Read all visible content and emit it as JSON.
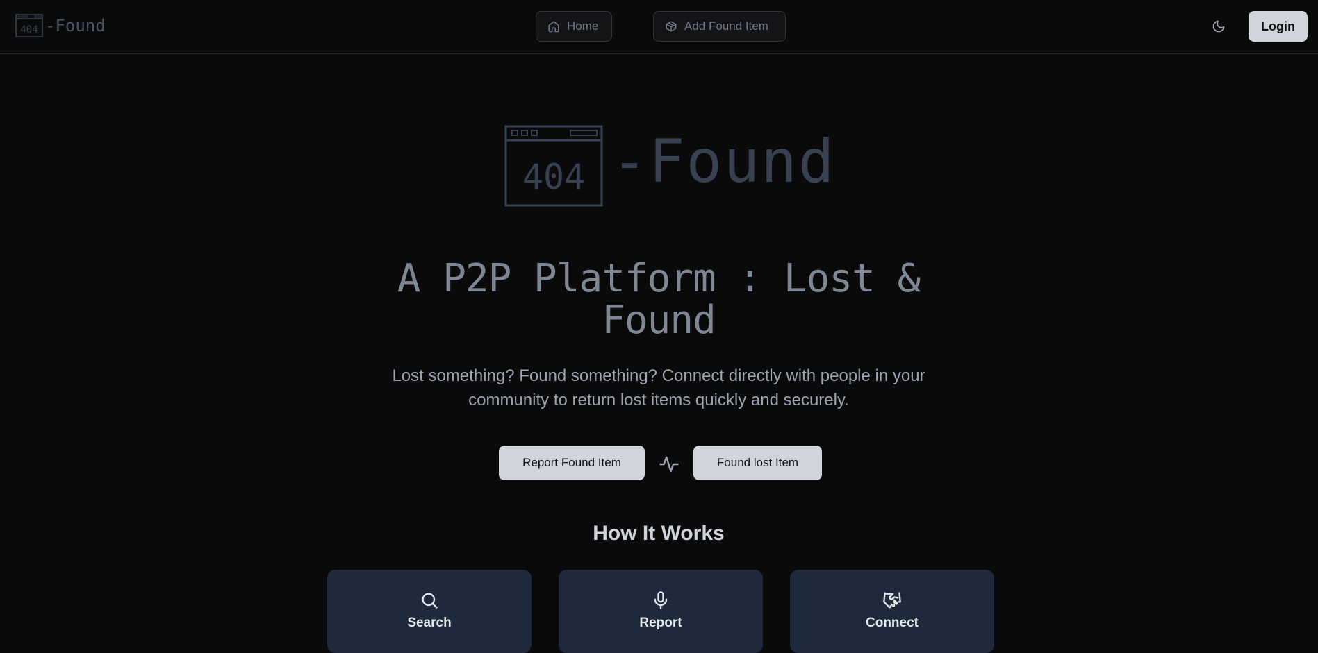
{
  "header": {
    "brand_text": "-Found",
    "logo_number": "404",
    "nav": [
      {
        "label": "Home",
        "icon": "home-icon"
      },
      {
        "label": "Add Found Item",
        "icon": "package-icon"
      }
    ],
    "theme_icon": "moon-icon",
    "login_label": "Login"
  },
  "hero": {
    "logo_number": "404",
    "logo_text": "-Found",
    "title": "A P2P Platform : Lost & Found",
    "description": "Lost something? Found something? Connect directly with people in your community to return lost items quickly and securely.",
    "cta": {
      "report_label": "Report Found Item",
      "found_label": "Found lost Item",
      "separator_icon": "activity-icon"
    }
  },
  "how_it_works": {
    "title": "How It Works",
    "cards": [
      {
        "label": "Search",
        "icon": "search-icon"
      },
      {
        "label": "Report",
        "icon": "microphone-icon"
      },
      {
        "label": "Connect",
        "icon": "handshake-icon"
      }
    ]
  },
  "colors": {
    "background": "#0a0a0a",
    "card": "#1e293b",
    "button_light": "#d1d5db",
    "muted_text": "#9ca3af",
    "logo_gray": "#374151"
  }
}
